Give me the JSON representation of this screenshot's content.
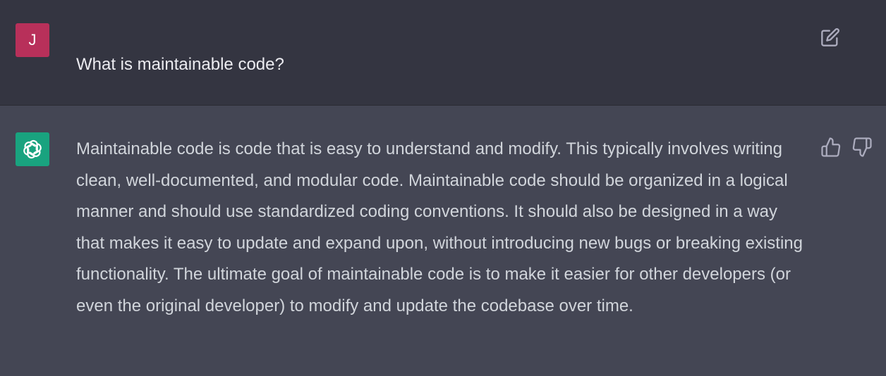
{
  "user_turn": {
    "avatar_letter": "J",
    "message": "What is maintainable code?",
    "edit_icon": "edit-icon"
  },
  "assistant_turn": {
    "avatar_icon": "openai-logo-icon",
    "message": "Maintainable code is code that is easy to understand and modify. This typically involves writing clean, well-documented, and modular code. Maintainable code should be organized in a logical manner and should use standardized coding conventions. It should also be designed in a way that makes it easy to update and expand upon, without introducing new bugs or breaking existing functionality. The ultimate goal of maintainable code is to make it easier for other developers (or even the original developer) to modify and update the codebase over time.",
    "feedback_icons": [
      "thumbs-up-icon",
      "thumbs-down-icon"
    ]
  },
  "colors": {
    "user_background": "#343541",
    "assistant_background": "#444654",
    "user_avatar": "#b8305a",
    "assistant_avatar": "#19a37f",
    "text": "#d1d5db"
  }
}
